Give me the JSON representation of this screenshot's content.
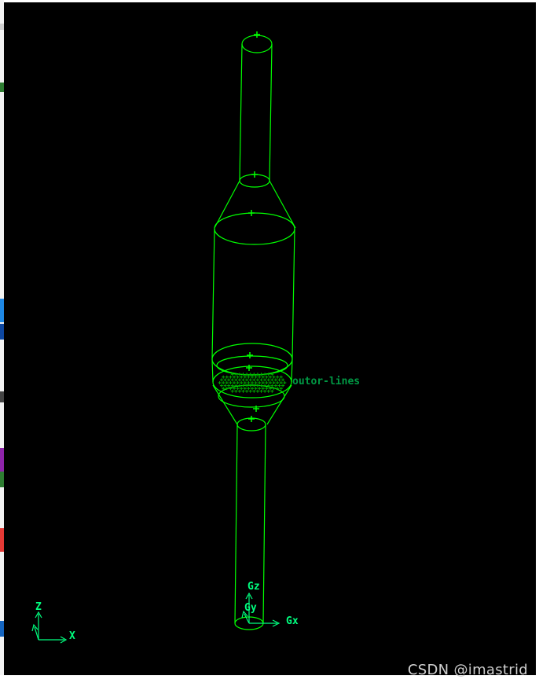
{
  "viewport": {
    "background": "#000000",
    "geometry_color": "#00ff00",
    "label_color": "#00ff7f",
    "group_label": "outor-lines"
  },
  "triad": {
    "z_label": "Z",
    "x_label": "X",
    "color": "#00ff7f"
  },
  "gravity": {
    "gz_label": "Gz",
    "gy_label": "Gy",
    "gx_label": "Gx",
    "color": "#00ff7f"
  },
  "watermark": {
    "text": "CSDN @imastrid"
  },
  "colors": {
    "left_strip_marks": [
      "#c0392b",
      "#1e88e5",
      "#e53935",
      "#444444"
    ]
  }
}
